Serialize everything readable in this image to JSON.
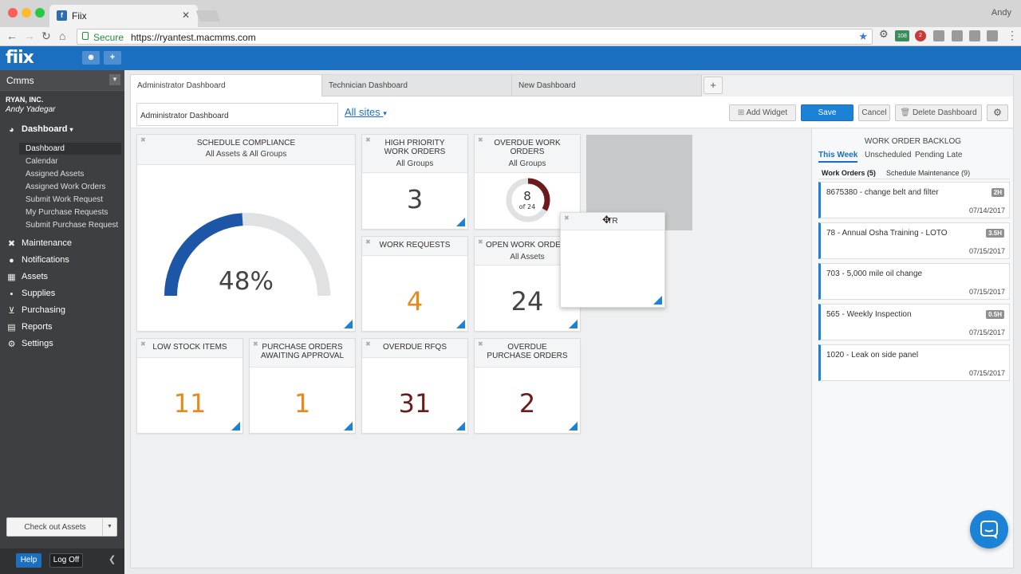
{
  "browser": {
    "tab_title": "Fiix",
    "user_name": "Andy",
    "secure_label": "Secure",
    "url": "https://ryantest.macmms.com",
    "ext_badges": [
      "108",
      "2"
    ]
  },
  "app": {
    "logo": "fiix",
    "system_select": "Cmms",
    "org_name": "RYAN, INC.",
    "user_name": "Andy Yadegar"
  },
  "sidebar": {
    "dashboard_label": "Dashboard",
    "dashboard_items": [
      "Dashboard",
      "Calendar",
      "Assigned Assets",
      "Assigned Work Orders",
      "Submit Work Request",
      "My Purchase Requests",
      "Submit Purchase Request"
    ],
    "sections": [
      "Maintenance",
      "Notifications",
      "Assets",
      "Supplies",
      "Purchasing",
      "Reports",
      "Settings"
    ],
    "checkout_label": "Check out Assets",
    "help_label": "Help",
    "logoff_label": "Log Off"
  },
  "dashboard_tabs": [
    "Administrator Dashboard",
    "Technician Dashboard",
    "New Dashboard"
  ],
  "add_tab_label": "+",
  "toolbar": {
    "dashboard_name": "Administrator Dashboard",
    "site_filter": "All sites",
    "add_widget": "Add Widget",
    "save": "Save",
    "cancel": "Cancel",
    "delete": "Delete Dashboard"
  },
  "widgets": {
    "schedule": {
      "title": "SCHEDULE COMPLIANCE",
      "subtitle": "All Assets & All Groups",
      "value": "48%",
      "fraction": 0.48
    },
    "high_priority": {
      "title": "HIGH PRIORITY WORK ORDERS",
      "subtitle": "All Groups",
      "value": "3",
      "color": "#444444"
    },
    "overdue_wo": {
      "title": "OVERDUE WORK ORDERS",
      "subtitle": "All Groups",
      "value": "8",
      "of_text": "of 24",
      "fraction": 0.333
    },
    "work_requests": {
      "title": "WORK REQUESTS",
      "value": "4",
      "color": "#e88a1a"
    },
    "open_wo": {
      "title": "OPEN WORK ORDERS",
      "subtitle": "All Assets",
      "value": "24",
      "color": "#444444"
    },
    "dragged": {
      "title": "TR"
    },
    "low_stock": {
      "title": "LOW STOCK ITEMS",
      "value": "11",
      "color": "#e88a1a"
    },
    "po_awaiting": {
      "title": "PURCHASE ORDERS AWAITING APPROVAL",
      "value": "1",
      "color": "#e88a1a"
    },
    "overdue_rfqs": {
      "title": "OVERDUE RFQS",
      "value": "31",
      "color": "#6b1b1b"
    },
    "overdue_po": {
      "title": "OVERDUE PURCHASE ORDERS",
      "value": "2",
      "color": "#6b1b1b"
    }
  },
  "backlog": {
    "title": "WORK ORDER BACKLOG",
    "tabs": [
      "This Week",
      "Unscheduled",
      "Pending",
      "Late"
    ],
    "subtabs": [
      "Work Orders (5)",
      "Schedule Maintenance (9)"
    ],
    "items": [
      {
        "title": "8675380 - change belt and filter",
        "badge": "2H",
        "date": "07/14/2017"
      },
      {
        "title": "78 - Annual Osha Training - LOTO",
        "badge": "3.5H",
        "date": "07/15/2017"
      },
      {
        "title": "703 - 5,000 mile oil change",
        "badge": "",
        "date": "07/15/2017"
      },
      {
        "title": "565 - Weekly Inspection",
        "badge": "0.5H",
        "date": "07/15/2017"
      },
      {
        "title": "1020 - Leak on side panel",
        "badge": "",
        "date": "07/15/2017"
      }
    ]
  },
  "colors": {
    "accent": "#1b82d6",
    "header": "#1b6fc0",
    "gauge": "#1d56a6",
    "donut": "#6b1b1b",
    "orange": "#e88a1a"
  }
}
